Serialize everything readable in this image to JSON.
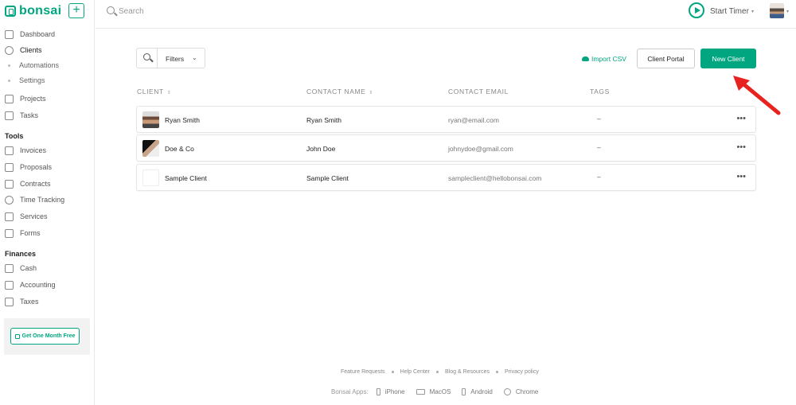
{
  "brand": {
    "name": "bonsai",
    "add_label": "+"
  },
  "sidebar": {
    "items": [
      {
        "label": "Dashboard",
        "icon": "home-icon"
      },
      {
        "label": "Clients",
        "icon": "clients-icon",
        "active": true
      },
      {
        "label": "Projects",
        "icon": "folder-icon"
      },
      {
        "label": "Tasks",
        "icon": "tasks-icon"
      }
    ],
    "client_subitems": [
      {
        "label": "Automations"
      },
      {
        "label": "Settings"
      }
    ],
    "tools_title": "Tools",
    "tools": [
      {
        "label": "Invoices",
        "icon": "invoice-icon"
      },
      {
        "label": "Proposals",
        "icon": "proposal-icon"
      },
      {
        "label": "Contracts",
        "icon": "contract-icon"
      },
      {
        "label": "Time Tracking",
        "icon": "clock-icon"
      },
      {
        "label": "Services",
        "icon": "services-icon"
      },
      {
        "label": "Forms",
        "icon": "forms-icon"
      }
    ],
    "finances_title": "Finances",
    "finances": [
      {
        "label": "Cash",
        "icon": "cash-icon"
      },
      {
        "label": "Accounting",
        "icon": "accounting-icon"
      },
      {
        "label": "Taxes",
        "icon": "taxes-icon"
      }
    ],
    "promo_label": "Get One Month Free"
  },
  "topbar": {
    "search_placeholder": "Search",
    "timer_label": "Start Timer",
    "caret": "▾"
  },
  "toolbar": {
    "filters_label": "Filters",
    "filters_chevron": "⌄",
    "import_label": "Import CSV",
    "client_portal_label": "Client Portal",
    "new_client_label": "New Client"
  },
  "table": {
    "headers": {
      "client": "CLIENT",
      "contact_name": "CONTACT NAME",
      "contact_email": "CONTACT EMAIL",
      "tags": "TAGS"
    },
    "sort_icon": "⇕",
    "rows": [
      {
        "client": "Ryan Smith",
        "contact": "Ryan Smith",
        "email": "ryan@email.com",
        "tags": "–",
        "more": "•••"
      },
      {
        "client": "Doe & Co",
        "contact": "John Doe",
        "email": "johnydoe@gmail.com",
        "tags": "–",
        "more": "•••"
      },
      {
        "client": "Sample Client",
        "contact": "Sample Client",
        "email": "sampleclient@hellobonsai.com",
        "tags": "–",
        "more": "•••"
      }
    ]
  },
  "footer": {
    "links": [
      "Feature Requests",
      "Help Center",
      "Blog & Resources",
      "Privacy policy"
    ],
    "apps_label": "Bonsai Apps:",
    "apps": [
      "iPhone",
      "MacOS",
      "Android",
      "Chrome"
    ]
  },
  "colors": {
    "accent": "#00a680",
    "annotation": "#e8231f"
  }
}
